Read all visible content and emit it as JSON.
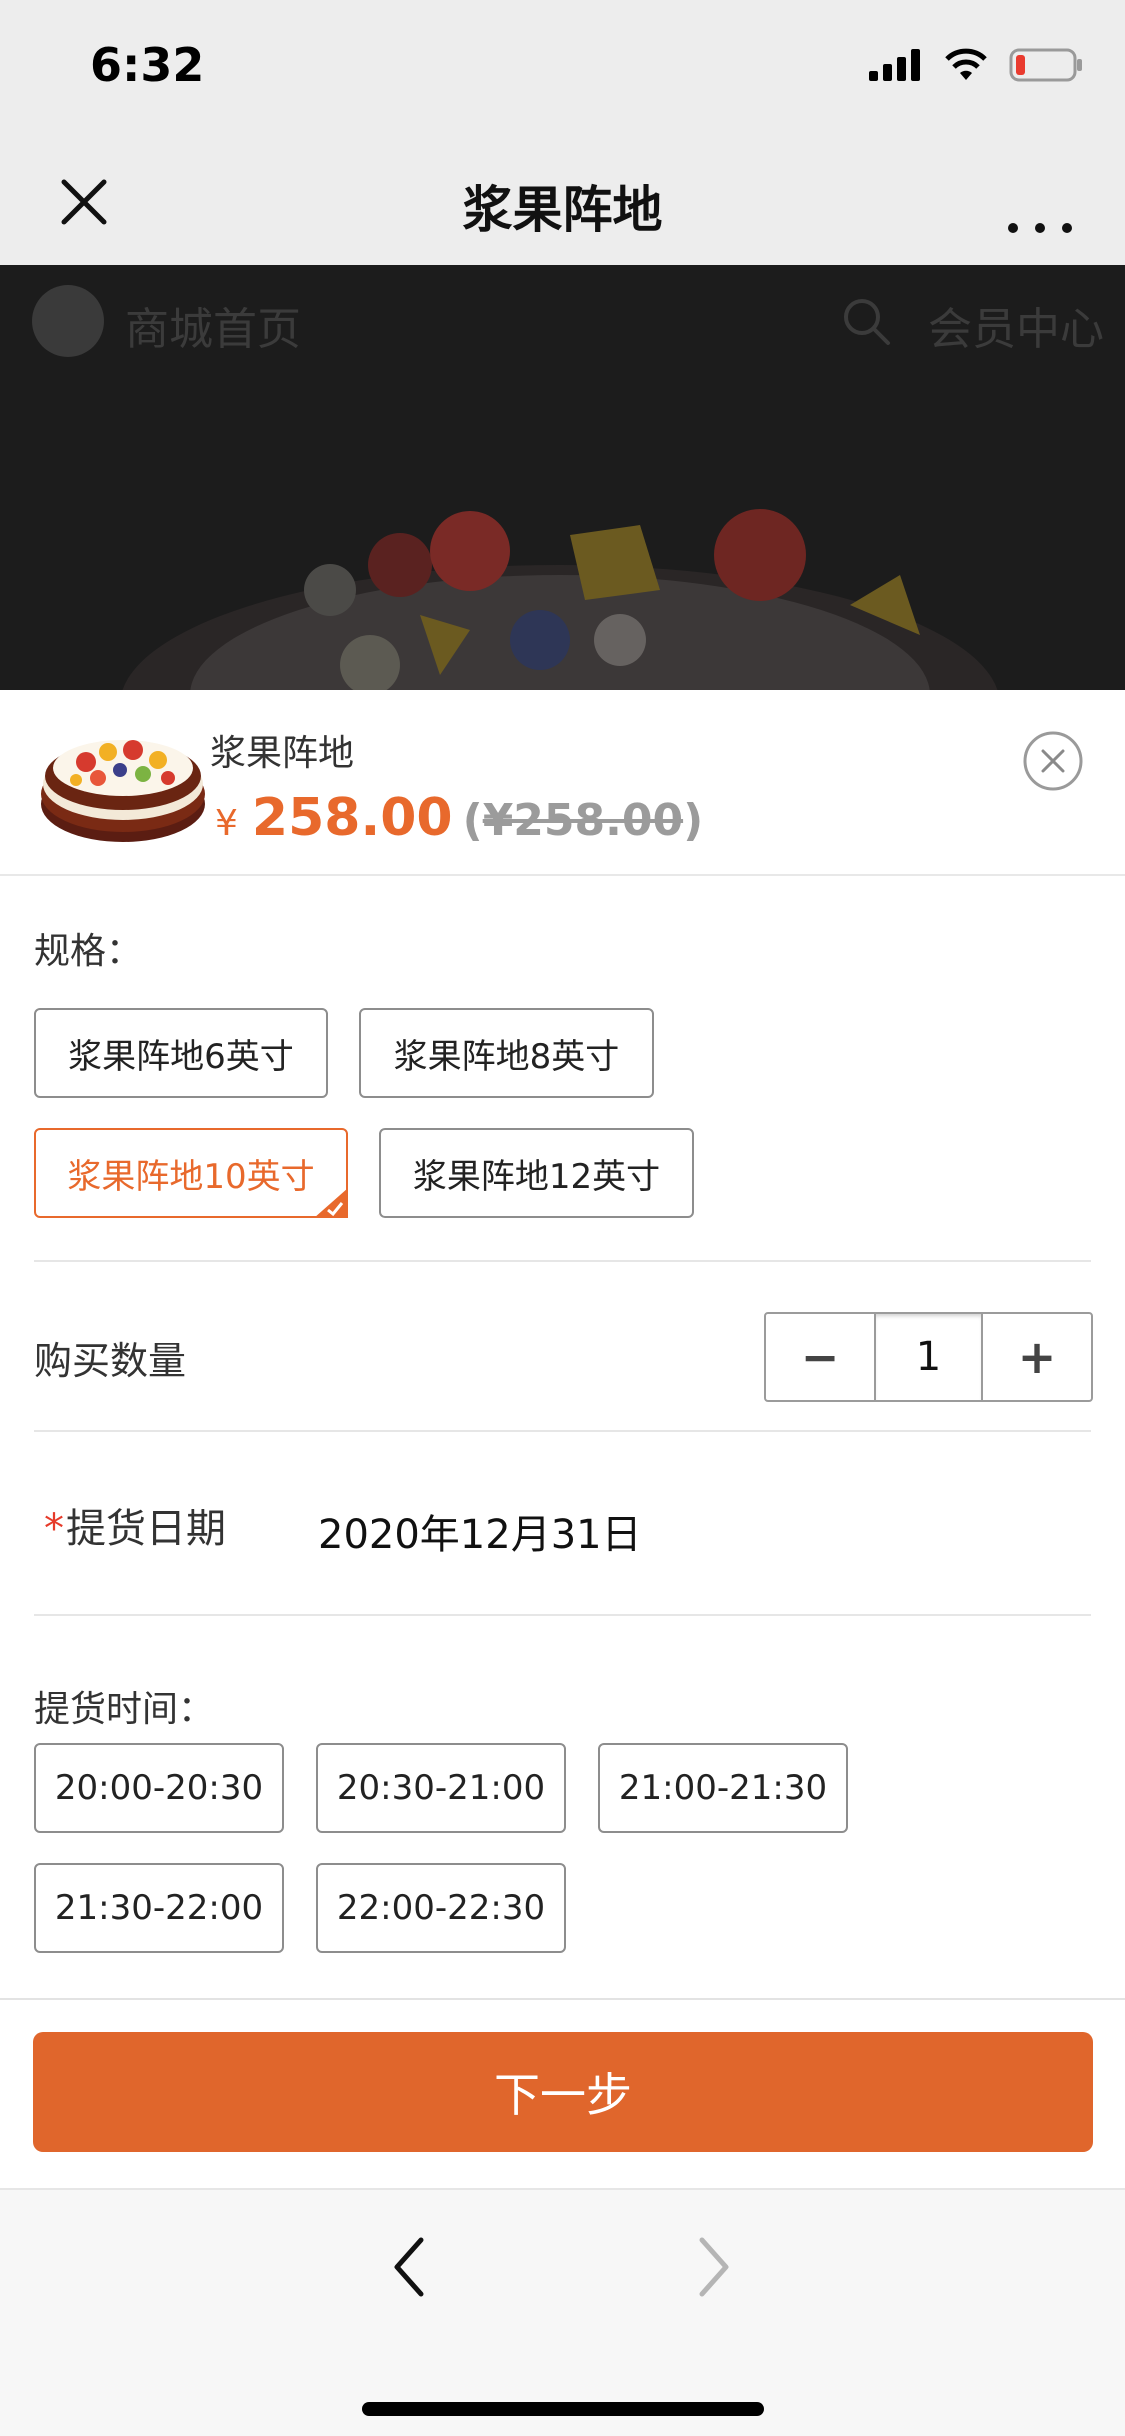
{
  "status_bar": {
    "time": "6:32"
  },
  "nav": {
    "title": "浆果阵地"
  },
  "web": {
    "home_label": "商城首页",
    "member_label": "会员中心"
  },
  "product": {
    "name": "浆果阵地",
    "currency_symbol": "¥",
    "price": "258.00",
    "original_price_open": "(",
    "original_price": "¥258.00",
    "original_price_close": ")"
  },
  "spec": {
    "label": "规格：",
    "options": [
      "浆果阵地6英寸",
      "浆果阵地8英寸",
      "浆果阵地10英寸",
      "浆果阵地12英寸"
    ],
    "selected": "浆果阵地10英寸"
  },
  "quantity": {
    "label": "购买数量",
    "minus": "−",
    "value": "1",
    "plus": "+"
  },
  "pickup_date": {
    "required_mark": "*",
    "label": "提货日期",
    "value": "2020年12月31日"
  },
  "pickup_time": {
    "label": "提货时间：",
    "slots": [
      "20:00-20:30",
      "20:30-21:00",
      "21:00-21:30",
      "21:30-22:00",
      "22:00-22:30"
    ]
  },
  "next_button": {
    "label": "下一步"
  },
  "colors": {
    "accent": "#e0662c",
    "price": "#e8692c",
    "required": "#e63b2a"
  }
}
